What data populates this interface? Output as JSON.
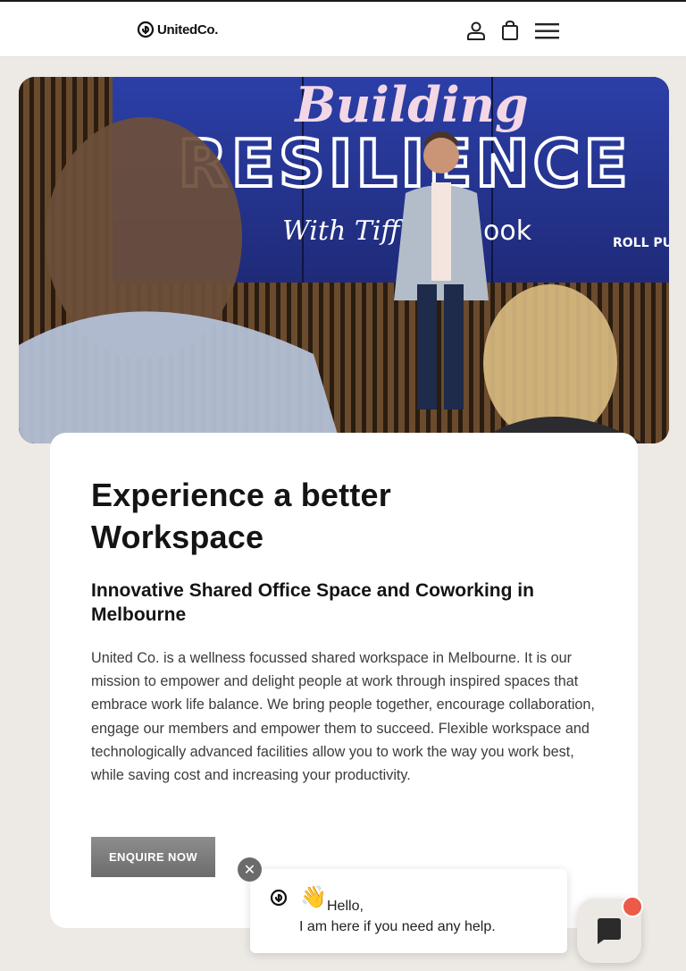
{
  "header": {
    "brand": "UnitedCo.",
    "account_icon": "user-icon",
    "cart_icon": "shopping-bag-icon",
    "menu_icon": "hamburger-menu-icon"
  },
  "hero": {
    "image_title_script": "Building",
    "image_title_main": "RESILIENCE",
    "image_subtitle": "With Tiff",
    "image_subtitle_tail": "ook",
    "image_side_label": "ROLL PUNCHE"
  },
  "content": {
    "heading": "Experience a better Workspace",
    "subheading": "Innovative Shared Office Space and Coworking in Melbourne",
    "body": "United Co. is a wellness focussed shared workspace in Melbourne. It is our mission to empower and delight people at work through inspired spaces that embrace work life balance. We bring people together, encourage collaboration, engage our members and empower them to succeed. Flexible workspace and technologically advanced facilities allow you to work the way you work best, while saving cost and increasing your productivity.",
    "cta_label": "ENQUIRE NOW"
  },
  "chat": {
    "wave": "👋",
    "greeting": "Hello,",
    "message": "I am here if you need any help.",
    "close_symbol": "✕",
    "launcher_icon": "chat-bubble-icon",
    "badge_color": "#ec5a48"
  },
  "colors": {
    "background": "#ede9e4",
    "card": "#ffffff",
    "cta": "#7a7a7a",
    "text": "#141414"
  }
}
